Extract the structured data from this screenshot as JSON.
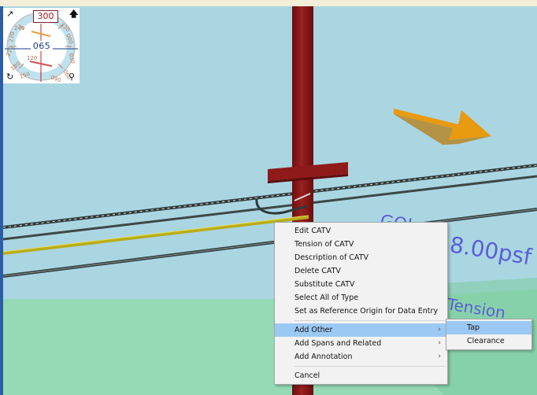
{
  "scene": {
    "colors": {
      "sky": "#aad6e2",
      "ground": "#95dab4",
      "pole": "#8e1a1a",
      "catv": "#b9ad1a",
      "arrow": "#e89a10",
      "label": "#5a5fd6"
    },
    "labels": [
      {
        "id": "load-label",
        "text": "8.00psf"
      },
      {
        "id": "tension-label",
        "text": "Tension"
      },
      {
        "id": "span-label",
        "text": "GOL"
      }
    ]
  },
  "compass": {
    "heading": "300",
    "value": "065",
    "tick_labels": [
      "240",
      "210",
      "180",
      "150",
      "120",
      "090",
      "060",
      "030",
      "000",
      "330",
      "270"
    ],
    "icons": [
      "pin-icon",
      "north-arrow-icon",
      "rotate-icon",
      "zoom-icon"
    ]
  },
  "context_menu": {
    "items": [
      {
        "label": "Edit CATV"
      },
      {
        "label": "Tension of CATV"
      },
      {
        "label": "Description of CATV"
      },
      {
        "label": "Delete CATV"
      },
      {
        "label": "Substitute CATV"
      },
      {
        "label": "Select All of Type"
      },
      {
        "label": "Set as Reference Origin for Data Entry"
      }
    ],
    "group2": [
      {
        "label": "Add Other",
        "submenu": true,
        "highlighted": true
      },
      {
        "label": "Add Spans and Related",
        "submenu": true
      },
      {
        "label": "Add Annotation",
        "submenu": true
      }
    ],
    "cancel": "Cancel",
    "arrow_glyph": "›"
  },
  "submenu": {
    "items": [
      {
        "label": "Tap",
        "highlighted": true
      },
      {
        "label": "Clearance"
      }
    ]
  }
}
